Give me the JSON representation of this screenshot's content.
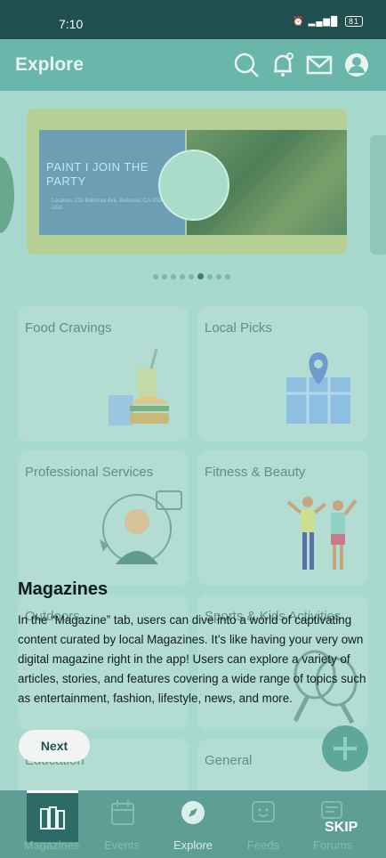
{
  "status": {
    "time": "7:10",
    "battery": "81"
  },
  "appbar": {
    "title": "Explore"
  },
  "banner": {
    "title": "PAINT I JOIN THE PARTY",
    "subtitle": "Location: 210 Bellmore Ave, Bellmore, CA 00000 USA"
  },
  "tiles": [
    {
      "label": "Food Cravings"
    },
    {
      "label": "Local Picks"
    },
    {
      "label": "Professional Services"
    },
    {
      "label": "Fitness & Beauty"
    },
    {
      "label": "Outdoors"
    },
    {
      "label": "Sports & Kids Activities"
    },
    {
      "label": "Education"
    },
    {
      "label": "General"
    }
  ],
  "tutorial": {
    "heading": "Magazines",
    "body": "In the “Magazine” tab, users can dive into a world of captivating content curated by local Magazines. It’s like having your very own digital magazine right in the app! Users can explore a variety of articles, stories, and features covering a wide range of topics such as entertainment, fashion, lifestyle, news, and more.",
    "next_label": "Next",
    "skip_label": "SKIP"
  },
  "nav": [
    {
      "label": "Magazines",
      "icon": "magazines-icon"
    },
    {
      "label": "Events",
      "icon": "calendar-icon"
    },
    {
      "label": "Explore",
      "icon": "compass-icon"
    },
    {
      "label": "Feeds",
      "icon": "feeds-icon"
    },
    {
      "label": "Forums",
      "icon": "forums-icon"
    }
  ],
  "colors": {
    "statusbar": "#1f4f4e",
    "accent": "#6ab6aa",
    "overlay": "#a7d9ce"
  }
}
